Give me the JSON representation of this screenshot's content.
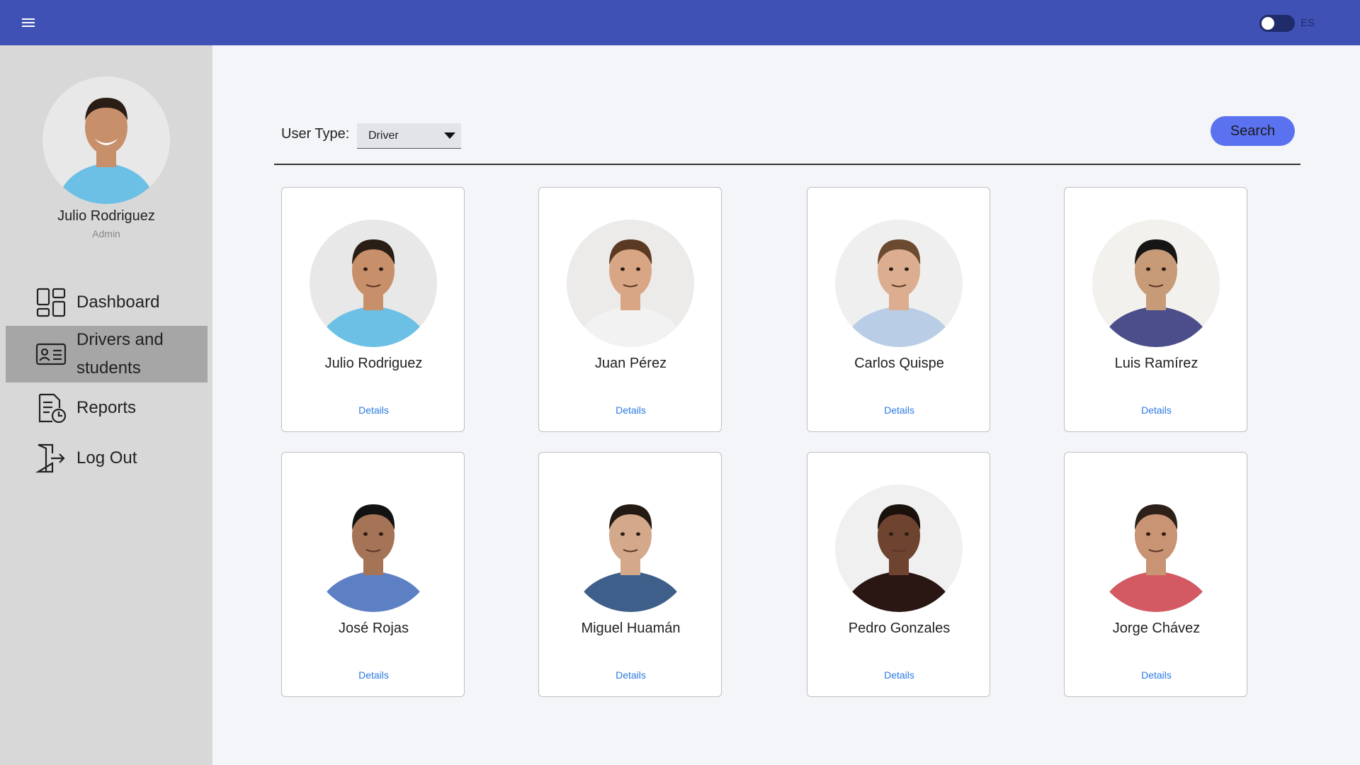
{
  "header": {
    "menu_icon": "hamburger-menu-icon",
    "language_label": "ES"
  },
  "sidebar": {
    "profile": {
      "name": "Julio Rodriguez",
      "role": "Admin"
    },
    "items": [
      {
        "label": "Dashboard",
        "icon": "dashboard-icon"
      },
      {
        "label": "Drivers and students",
        "line1": "Drivers and",
        "line2": "students",
        "icon": "id-card-icon",
        "active": true
      },
      {
        "label": "Reports",
        "icon": "report-icon"
      },
      {
        "label": "Log Out",
        "icon": "logout-icon"
      }
    ]
  },
  "filter": {
    "label": "User Type:",
    "selected": "Driver",
    "search_label": "Search"
  },
  "cards": [
    {
      "name": "Julio Rodriguez",
      "details": "Details",
      "shirt": "#6cc0e5",
      "skin": "#c8906a",
      "hair": "#2a1d15",
      "bg": "#e8e8e8"
    },
    {
      "name": "Juan Pérez",
      "details": "Details",
      "shirt": "#f2f2f2",
      "skin": "#d9a685",
      "hair": "#5a3a22",
      "bg": "#ecebea"
    },
    {
      "name": "Carlos Quispe",
      "details": "Details",
      "shirt": "#b9cde6",
      "skin": "#dcae8f",
      "hair": "#6b4a30",
      "bg": "#efefef"
    },
    {
      "name": "Luis Ramírez",
      "details": "Details",
      "shirt": "#4b4e8a",
      "skin": "#c79a78",
      "hair": "#151515",
      "bg": "#f3f1ee"
    },
    {
      "name": "José Rojas",
      "details": "Details",
      "shirt": "#5d80c4",
      "skin": "#a57356",
      "hair": "#121212",
      "bg": "#ffffff"
    },
    {
      "name": "Miguel Huamán",
      "details": "Details",
      "shirt": "#3d5f8a",
      "skin": "#d4a98b",
      "hair": "#241a14",
      "bg": "#ffffff"
    },
    {
      "name": "Pedro Gonzales",
      "details": "Details",
      "shirt": "#2a1612",
      "skin": "#6e4330",
      "hair": "#1a100c",
      "bg": "#f0f0f0"
    },
    {
      "name": "Jorge Chávez",
      "details": "Details",
      "shirt": "#d35a62",
      "skin": "#c89473",
      "hair": "#2c2018",
      "bg": "#ffffff"
    }
  ]
}
